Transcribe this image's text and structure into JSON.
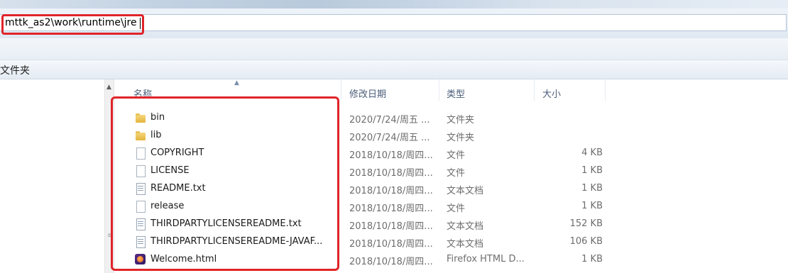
{
  "address": {
    "path": "mttk_as2\\work\\runtime\\jre"
  },
  "breadcrumb": {
    "label": "文件夹"
  },
  "columns": {
    "name": "名称",
    "date": "修改日期",
    "type": "类型",
    "size": "大小"
  },
  "files": [
    {
      "name": "bin",
      "date": "2020/7/24/周五 ...",
      "type": "文件夹",
      "size": "",
      "icon": "folder-icon"
    },
    {
      "name": "lib",
      "date": "2020/7/24/周五 ...",
      "type": "文件夹",
      "size": "",
      "icon": "folder-icon"
    },
    {
      "name": "COPYRIGHT",
      "date": "2018/10/18/周四...",
      "type": "文件",
      "size": "4 KB",
      "icon": "file-icon"
    },
    {
      "name": "LICENSE",
      "date": "2018/10/18/周四...",
      "type": "文件",
      "size": "1 KB",
      "icon": "file-icon"
    },
    {
      "name": "README.txt",
      "date": "2018/10/18/周四...",
      "type": "文本文档",
      "size": "1 KB",
      "icon": "text-file-icon"
    },
    {
      "name": "release",
      "date": "2018/10/18/周四...",
      "type": "文件",
      "size": "1 KB",
      "icon": "file-icon"
    },
    {
      "name": "THIRDPARTYLICENSEREADME.txt",
      "date": "2018/10/18/周四...",
      "type": "文本文档",
      "size": "152 KB",
      "icon": "text-file-icon"
    },
    {
      "name": "THIRDPARTYLICENSEREADME-JAVAF...",
      "date": "2018/10/18/周四...",
      "type": "文本文档",
      "size": "106 KB",
      "icon": "text-file-icon"
    },
    {
      "name": "Welcome.html",
      "date": "2018/10/18/周四...",
      "type": "Firefox HTML D...",
      "size": "1 KB",
      "icon": "firefox-html-icon"
    }
  ],
  "colors": {
    "highlight": "#e0242a",
    "header_text": "#4a5d78"
  }
}
